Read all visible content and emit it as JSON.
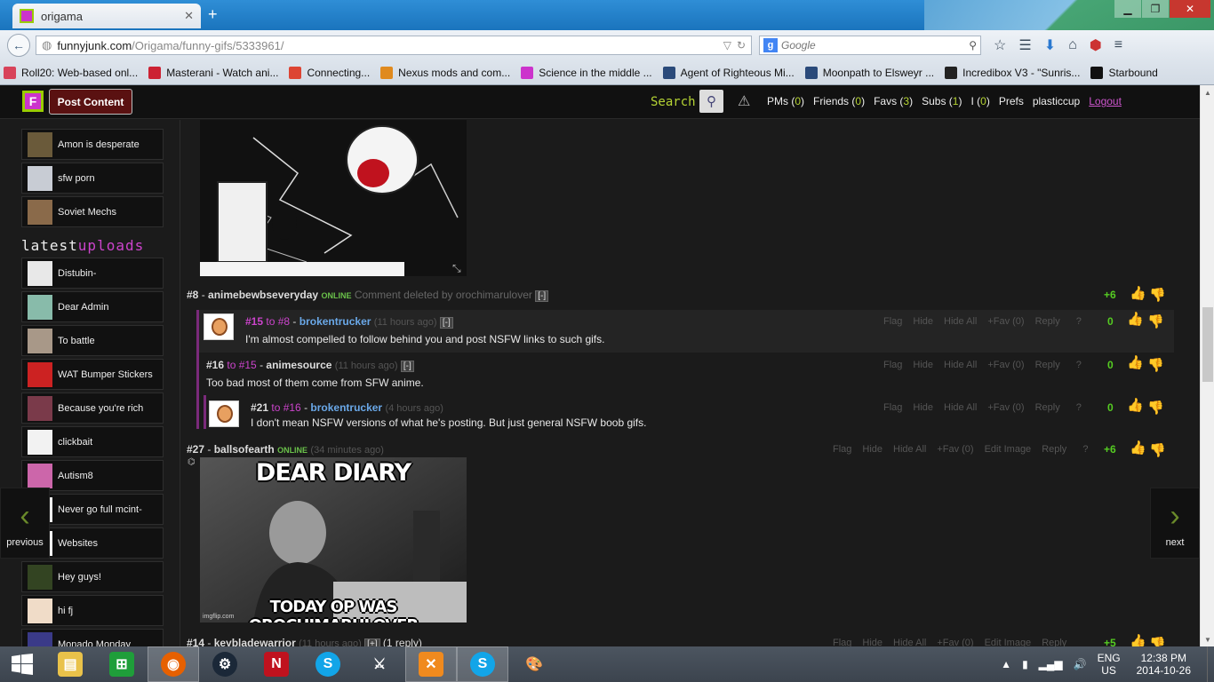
{
  "browser": {
    "tab_title": "origama",
    "url_host": "funnyjunk.com",
    "url_path": "/Origama/funny-gifs/5333961/",
    "search_placeholder": "Google",
    "bookmarks": [
      {
        "label": "Roll20: Web-based onl...",
        "color": "#d8435a"
      },
      {
        "label": "Masterani - Watch ani...",
        "color": "#cc2233"
      },
      {
        "label": "Connecting...",
        "color": "#dd4433"
      },
      {
        "label": "Nexus mods and com...",
        "color": "#e08a1e"
      },
      {
        "label": "Science in the middle ...",
        "color": "#cc33cc"
      },
      {
        "label": "Agent of Righteous Mi...",
        "color": "#2a4a7a"
      },
      {
        "label": "Moonpath to Elsweyr ...",
        "color": "#2a4a7a"
      },
      {
        "label": "Incredibox V3 - \"Sunris...",
        "color": "#222222"
      },
      {
        "label": "Starbound",
        "color": "#111111"
      }
    ]
  },
  "site": {
    "post_content": "Post Content",
    "search_label": "Search",
    "nav": {
      "pms_label": "PMs (",
      "pms_count": "0",
      "friends_label": "Friends (",
      "friends_count": "0",
      "favs_label": "Favs (",
      "favs_count": "3",
      "subs_label": "Subs (",
      "subs_count": "1",
      "i_label": "I (",
      "i_count": "0",
      "close_paren": ")",
      "prefs": "Prefs",
      "username": "plasticcup",
      "logout": "Logout"
    }
  },
  "sidebar": {
    "top_items": [
      {
        "label": "Amon is desperate",
        "thumb": "#6a5a3a"
      },
      {
        "label": "sfw porn",
        "thumb": "#c8ccd4"
      },
      {
        "label": "Soviet Mechs",
        "thumb": "#8a6a4a"
      }
    ],
    "latest_label": "latest",
    "uploads_label": "uploads",
    "latest_items": [
      {
        "label": "Distubin-",
        "thumb": "#e8e8e8"
      },
      {
        "label": "Dear Admin",
        "thumb": "#88bbaa"
      },
      {
        "label": "To battle",
        "thumb": "#a89888"
      },
      {
        "label": "WAT Bumper Stickers",
        "thumb": "#cc2222"
      },
      {
        "label": "Because you're rich",
        "thumb": "#7a3a4a"
      },
      {
        "label": "clickbait",
        "thumb": "#f2f2f2"
      },
      {
        "label": "Autism8",
        "thumb": "#cc66aa"
      },
      {
        "label": "Never go full mcint-",
        "thumb": "#eeeeee"
      },
      {
        "label": "Websites",
        "thumb": "#f4f4f4"
      },
      {
        "label": "Hey guys!",
        "thumb": "#334422"
      },
      {
        "label": "hi fj",
        "thumb": "#f0dcc8"
      },
      {
        "label": "Monado Monday",
        "thumb": "#3a3a88"
      }
    ]
  },
  "comments": {
    "c8": {
      "num": "#8",
      "sep": " - ",
      "author": "animebewbseveryday",
      "online": "ONLINE",
      "deleted": "Comment deleted by orochimarulover",
      "toggle": "[-]",
      "score": "+6"
    },
    "c15": {
      "num": "#15",
      "to": " to #8",
      "sep": " - ",
      "author": "brokentrucker",
      "ago": "(11 hours ago)",
      "toggle": "[-]",
      "text": "I'm almost compelled to follow behind you and post NSFW links to such gifs.",
      "score": "0"
    },
    "c16": {
      "num": "#16",
      "to": " to #15",
      "sep": " - ",
      "author": "animesource",
      "ago": "(11 hours ago)",
      "toggle": "[-]",
      "text": "Too bad most of them come from SFW anime.",
      "score": "0"
    },
    "c21": {
      "num": "#21",
      "to": " to #16",
      "sep": " - ",
      "author": "brokentrucker",
      "ago": "(4 hours ago)",
      "text": "I don't mean NSFW versions of what he's posting. But just general NSFW boob gifs.",
      "score": "0"
    },
    "c27": {
      "num": "#27",
      "sep": " - ",
      "author": "ballsofearth",
      "online": "ONLINE",
      "ago": "(34 minutes ago)",
      "score": "+6",
      "image_top": "DEAR DIARY",
      "image_bottom": "TODAY OP WAS OROCHIMARULOVER",
      "image_watermark": "imgflip.com"
    },
    "c14": {
      "num": "#14",
      "sep": " - ",
      "author": "keybladewarrior",
      "ago": "(11 hours ago)",
      "toggle": "[+]",
      "replies": "(1 reply)",
      "score": "+5"
    }
  },
  "actions": {
    "flag": "Flag",
    "hide": "Hide",
    "hide_all": "Hide All",
    "fav": "+Fav (0)",
    "edit_image": "Edit Image",
    "reply": "Reply",
    "help": "?"
  },
  "pager": {
    "previous": "previous",
    "next": "next"
  },
  "taskbar": {
    "lang_top": "ENG",
    "lang_bottom": "US",
    "time": "12:38 PM",
    "date": "2014-10-26"
  }
}
